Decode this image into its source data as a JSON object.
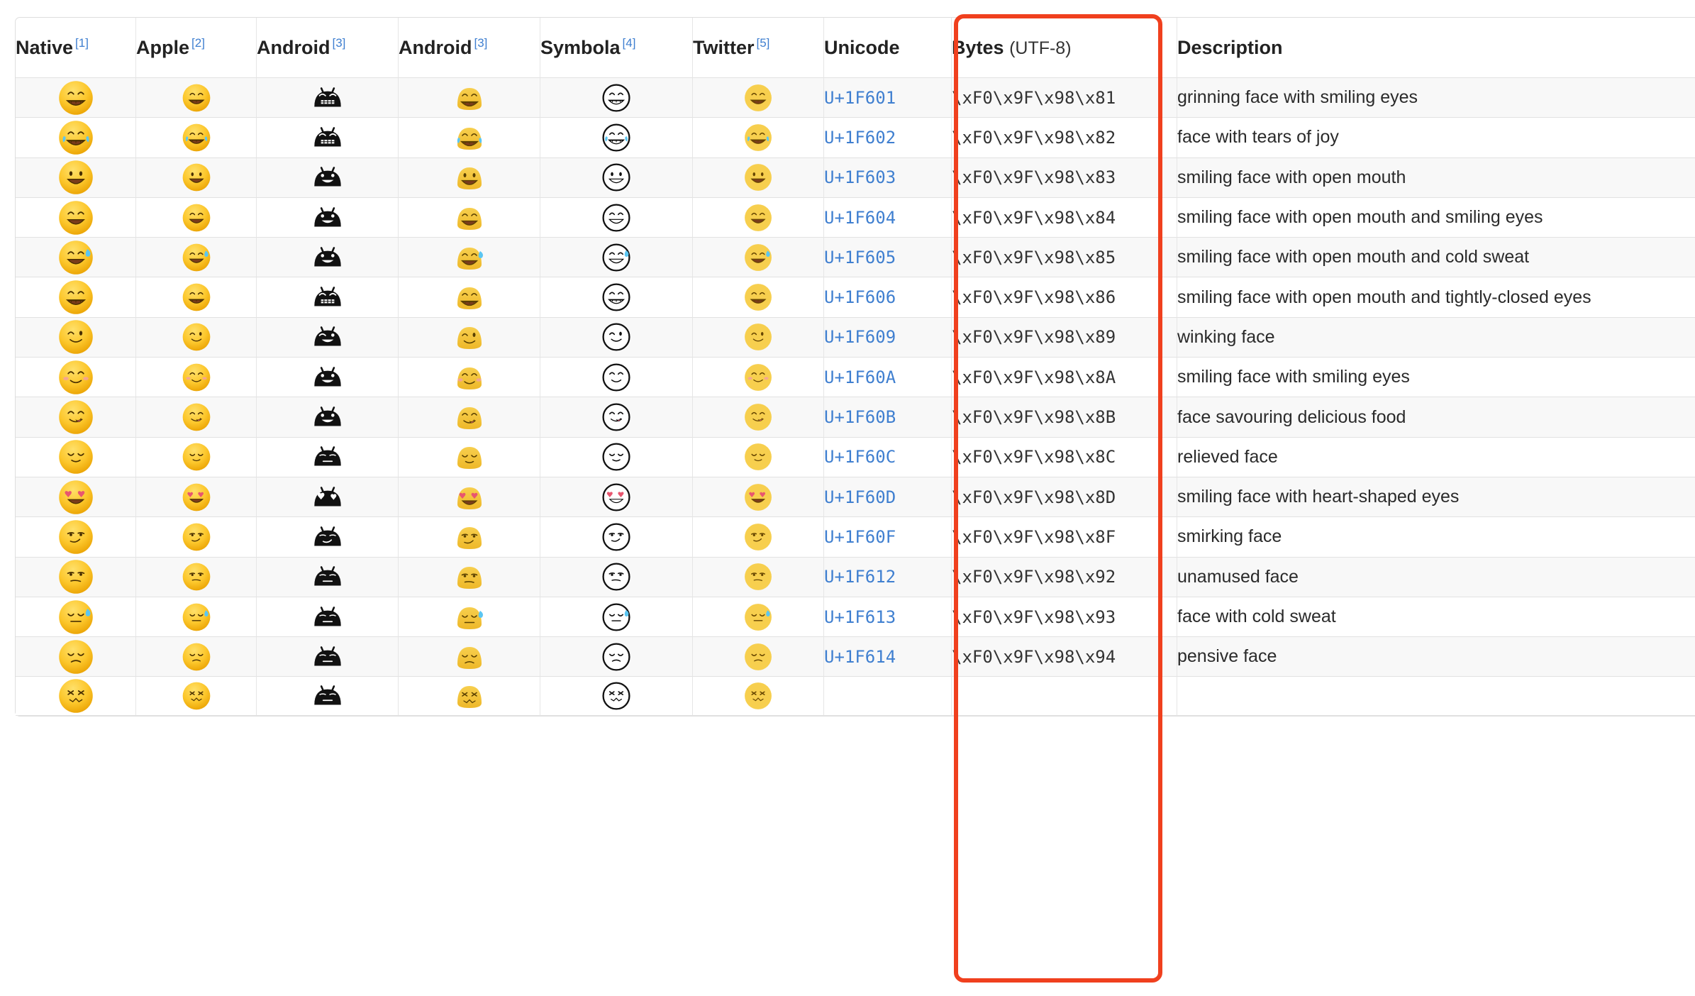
{
  "table": {
    "columns": [
      {
        "key": "native",
        "label": "Native",
        "footnote": "[1]"
      },
      {
        "key": "apple",
        "label": "Apple",
        "footnote": "[2]"
      },
      {
        "key": "android1",
        "label": "Android",
        "footnote": "[3]"
      },
      {
        "key": "android2",
        "label": "Android",
        "footnote": "[3]"
      },
      {
        "key": "symbola",
        "label": "Symbola",
        "footnote": "[4]"
      },
      {
        "key": "twitter",
        "label": "Twitter",
        "footnote": "[5]"
      },
      {
        "key": "unicode",
        "label": "Unicode",
        "footnote": ""
      },
      {
        "key": "bytes",
        "label": "Bytes",
        "footnote": "",
        "sub": "(UTF-8)"
      },
      {
        "key": "desc",
        "label": "Description",
        "footnote": ""
      }
    ],
    "rows": [
      {
        "emoji": "😁",
        "unicode": "U+1F601",
        "bytes": "\\xF0\\x9F\\x98\\x81",
        "desc": "grinning face with smiling eyes"
      },
      {
        "emoji": "😂",
        "unicode": "U+1F602",
        "bytes": "\\xF0\\x9F\\x98\\x82",
        "desc": "face with tears of joy"
      },
      {
        "emoji": "😃",
        "unicode": "U+1F603",
        "bytes": "\\xF0\\x9F\\x98\\x83",
        "desc": "smiling face with open mouth"
      },
      {
        "emoji": "😄",
        "unicode": "U+1F604",
        "bytes": "\\xF0\\x9F\\x98\\x84",
        "desc": "smiling face with open mouth and smiling eyes"
      },
      {
        "emoji": "😅",
        "unicode": "U+1F605",
        "bytes": "\\xF0\\x9F\\x98\\x85",
        "desc": "smiling face with open mouth and cold sweat"
      },
      {
        "emoji": "😆",
        "unicode": "U+1F606",
        "bytes": "\\xF0\\x9F\\x98\\x86",
        "desc": "smiling face with open mouth and tightly-closed eyes"
      },
      {
        "emoji": "😉",
        "unicode": "U+1F609",
        "bytes": "\\xF0\\x9F\\x98\\x89",
        "desc": "winking face"
      },
      {
        "emoji": "😊",
        "unicode": "U+1F60A",
        "bytes": "\\xF0\\x9F\\x98\\x8A",
        "desc": "smiling face with smiling eyes"
      },
      {
        "emoji": "😋",
        "unicode": "U+1F60B",
        "bytes": "\\xF0\\x9F\\x98\\x8B",
        "desc": "face savouring delicious food"
      },
      {
        "emoji": "😌",
        "unicode": "U+1F60C",
        "bytes": "\\xF0\\x9F\\x98\\x8C",
        "desc": "relieved face"
      },
      {
        "emoji": "😍",
        "unicode": "U+1F60D",
        "bytes": "\\xF0\\x9F\\x98\\x8D",
        "desc": "smiling face with heart-shaped eyes"
      },
      {
        "emoji": "😏",
        "unicode": "U+1F60F",
        "bytes": "\\xF0\\x9F\\x98\\x8F",
        "desc": "smirking face"
      },
      {
        "emoji": "😒",
        "unicode": "U+1F612",
        "bytes": "\\xF0\\x9F\\x98\\x92",
        "desc": "unamused face"
      },
      {
        "emoji": "😓",
        "unicode": "U+1F613",
        "bytes": "\\xF0\\x9F\\x98\\x93",
        "desc": "face with cold sweat"
      },
      {
        "emoji": "😔",
        "unicode": "U+1F614",
        "bytes": "\\xF0\\x9F\\x98\\x94",
        "desc": "pensive face"
      },
      {
        "emoji": "😖",
        "unicode": "",
        "bytes": "",
        "desc": ""
      }
    ]
  },
  "annotation": {
    "highlight_color": "#f0401e",
    "highlighted_column": "Bytes (UTF-8)"
  },
  "colors": {
    "link": "#3f7fd0",
    "header_text": "#222222",
    "body_text": "#2a2a2a",
    "row_alt_bg": "#f8f8f8",
    "border": "#e2e2e2"
  }
}
